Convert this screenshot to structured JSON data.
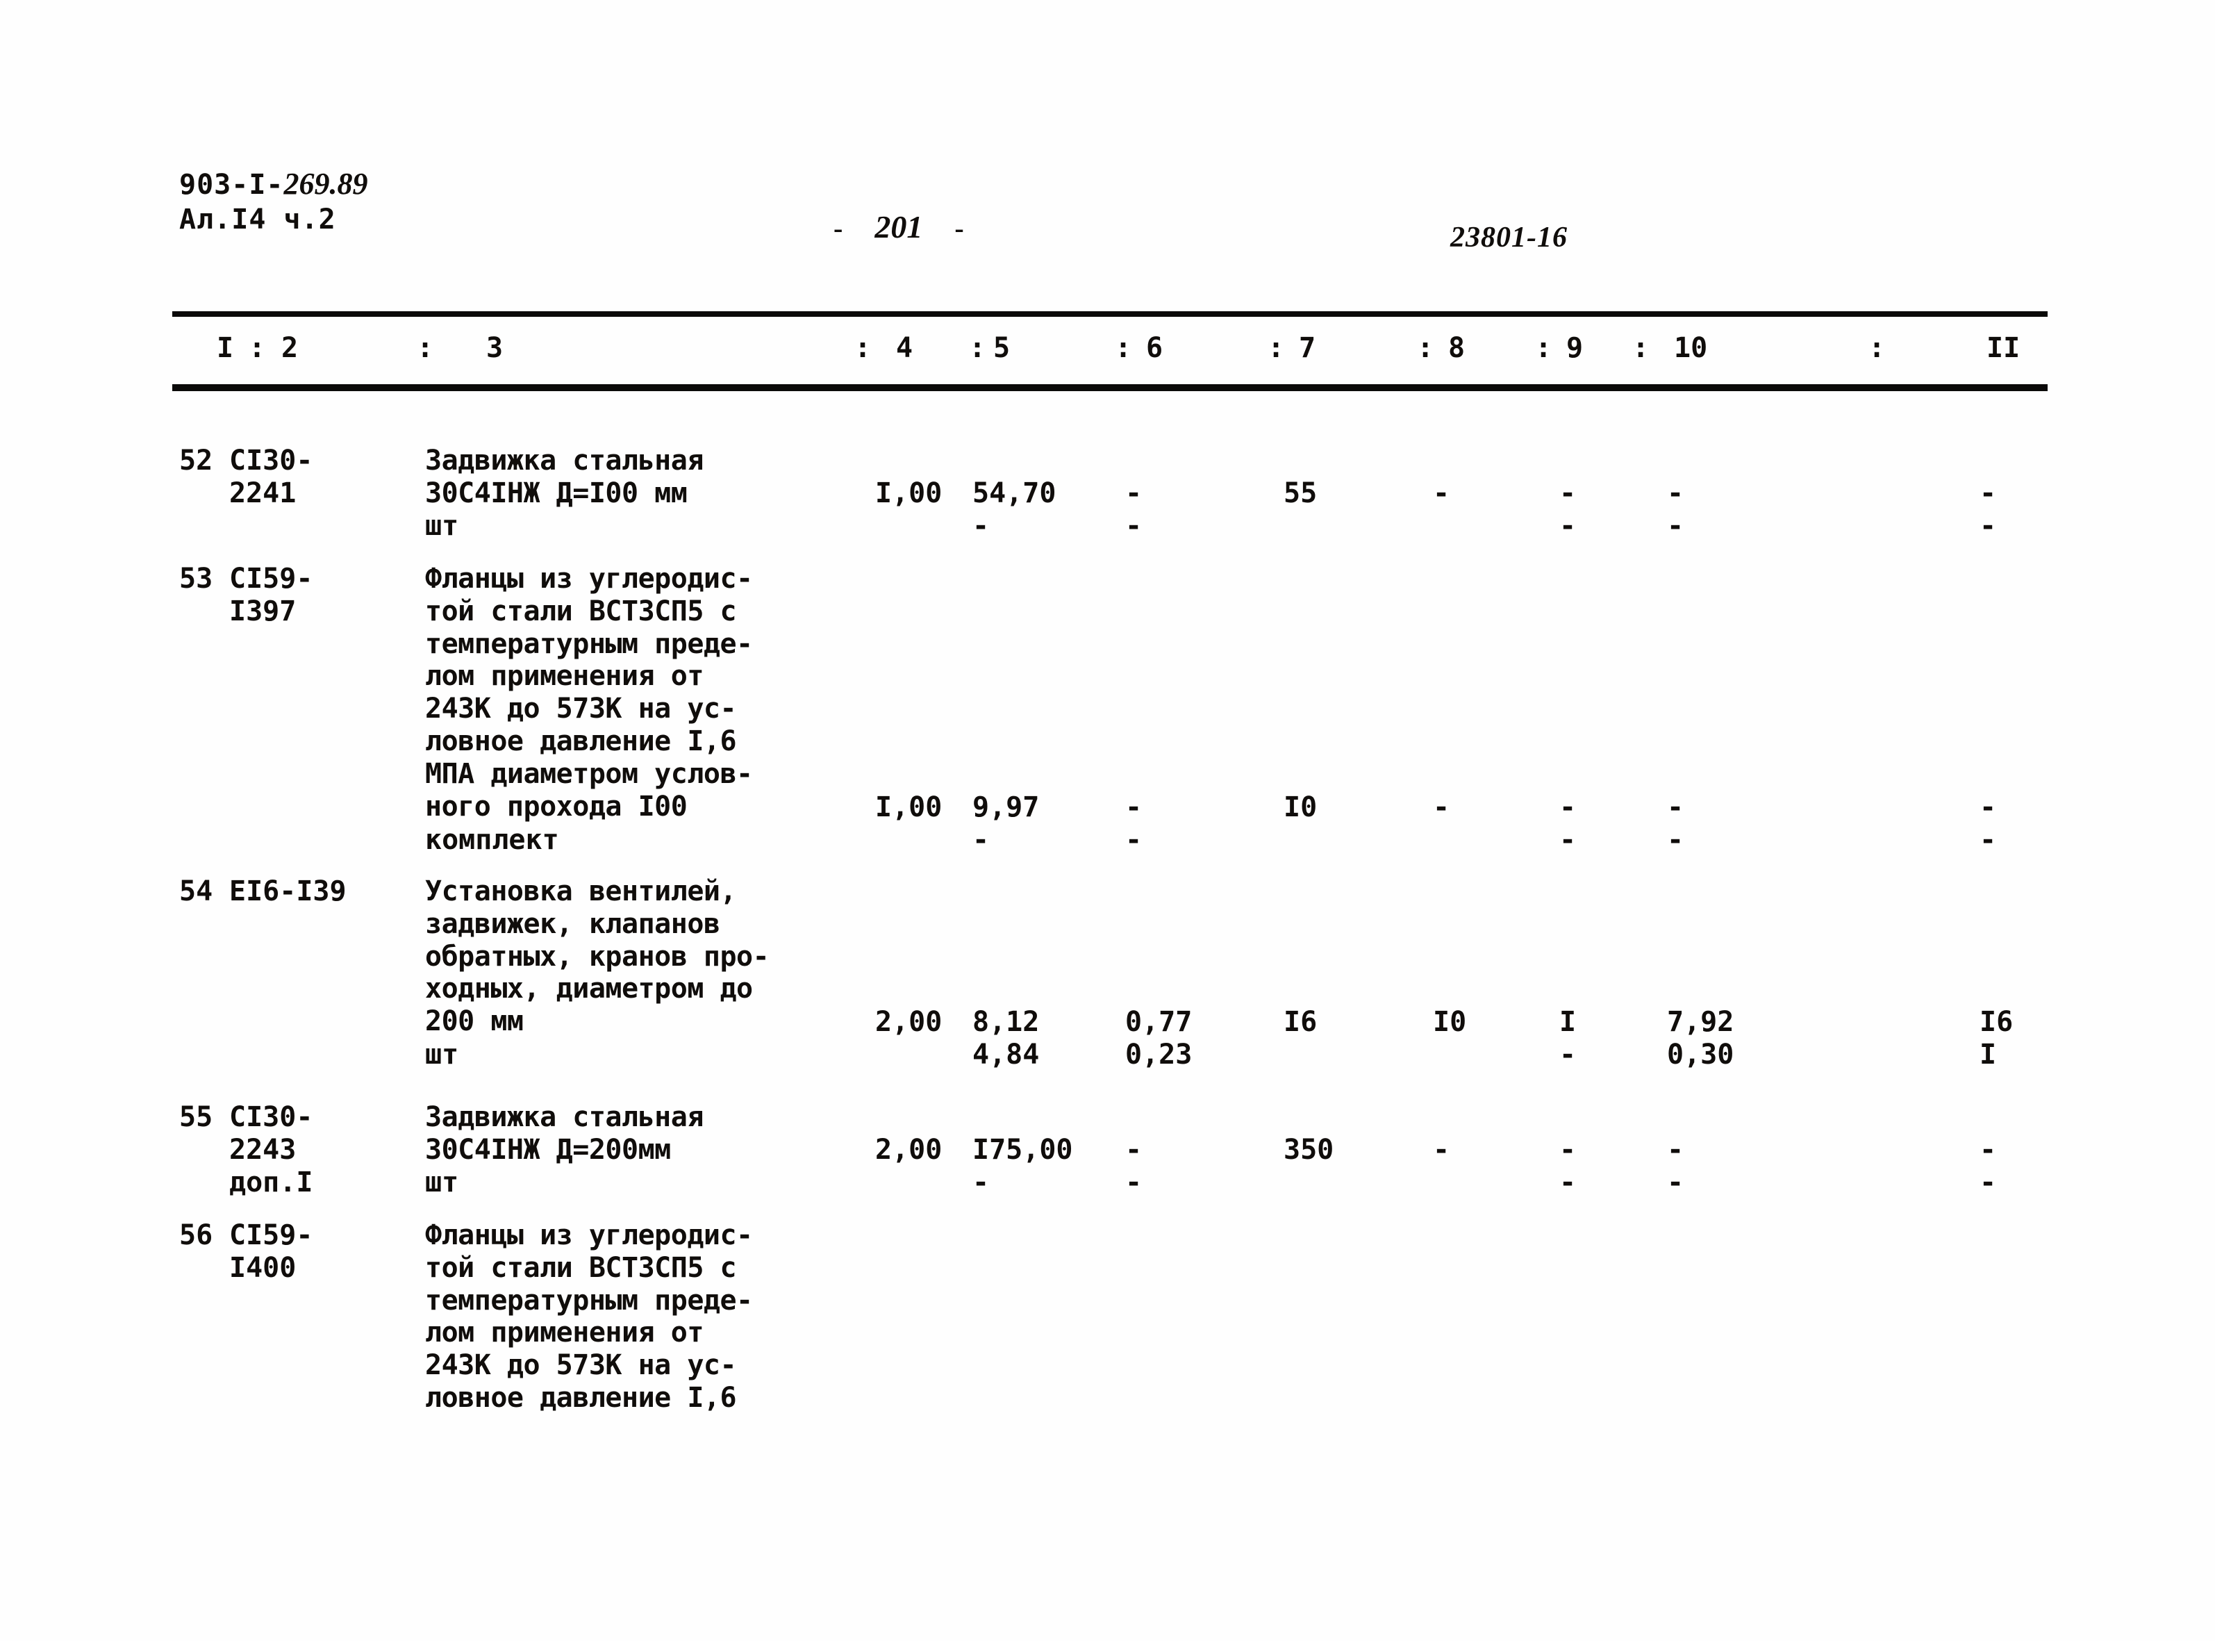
{
  "header": {
    "doc_code_printed": "903-I-",
    "doc_code_hand": "269.89",
    "sheet_label": "Ал.I4 ч.2",
    "page_dash_left": "-",
    "page_number": "201",
    "page_dash_right": "-",
    "sheet_code": "23801-16"
  },
  "table": {
    "column_headers": [
      "I",
      "2",
      "3",
      "4",
      "5",
      "6",
      "7",
      "8",
      "9",
      "10",
      "II"
    ],
    "separator": ":",
    "rows": [
      {
        "no": "52",
        "code": "CI30-\n2241",
        "description": "Задвижка стальная\n30С4IНЖ Д=I00 мм",
        "unit": "шт",
        "col4": "I,00",
        "col5": "54,70",
        "col5b": "-",
        "col6": "-",
        "col6b": "-",
        "col7": "55",
        "col7b": "",
        "col8": "-",
        "col8b": "",
        "col9": "-",
        "col9b": "-",
        "col10": "-",
        "col10b": "-",
        "col11": "-",
        "col11b": "-"
      },
      {
        "no": "53",
        "code": "CI59-\nI397",
        "description": "Фланцы из углеродис-\nтой стали ВСТ3СП5 с\nтемпературным преде-\nлом применения от\n243К до 573К на ус-\nловное давление I,6\nМПА диаметром услов-\nного прохода I00",
        "unit": "комплект",
        "col4": "I,00",
        "col5": "9,97",
        "col5b": "-",
        "col6": "-",
        "col6b": "-",
        "col7": "I0",
        "col7b": "",
        "col8": "-",
        "col8b": "",
        "col9": "-",
        "col9b": "-",
        "col10": "-",
        "col10b": "-",
        "col11": "-",
        "col11b": "-"
      },
      {
        "no": "54",
        "code": "EI6-I39",
        "description": "Установка вентилей,\nзадвижек, клапанов\nобратных, кранов про-\nходных, диаметром до\n200 мм",
        "unit": "шт",
        "col4": "2,00",
        "col5": "8,12",
        "col5b": "4,84",
        "col6": "0,77",
        "col6b": "0,23",
        "col7": "I6",
        "col7b": "",
        "col8": "I0",
        "col8b": "",
        "col9": "I",
        "col9b": "-",
        "col10": "7,92",
        "col10b": "0,30",
        "col11": "I6",
        "col11b": "I"
      },
      {
        "no": "55",
        "code": "CI30-\n2243\nдоп.I",
        "description": "Задвижка стальная\n30С4IНЖ Д=200мм",
        "unit": "шт",
        "col4": "2,00",
        "col5": "I75,00",
        "col5b": "-",
        "col6": "-",
        "col6b": "-",
        "col7": "350",
        "col7b": "",
        "col8": "-",
        "col8b": "",
        "col9": "-",
        "col9b": "-",
        "col10": "-",
        "col10b": "-",
        "col11": "-",
        "col11b": "-"
      },
      {
        "no": "56",
        "code": "CI59-\nI400",
        "description": "Фланцы из углеродис-\nтой стали ВСТ3СП5 с\nтемпературным преде-\nлом применения от\n243К до 573К на ус-\nловное давление I,6",
        "unit": "",
        "col4": "",
        "col5": "",
        "col5b": "",
        "col6": "",
        "col6b": "",
        "col7": "",
        "col7b": "",
        "col8": "",
        "col8b": "",
        "col9": "",
        "col9b": "",
        "col10": "",
        "col10b": "",
        "col11": "",
        "col11b": ""
      }
    ]
  }
}
